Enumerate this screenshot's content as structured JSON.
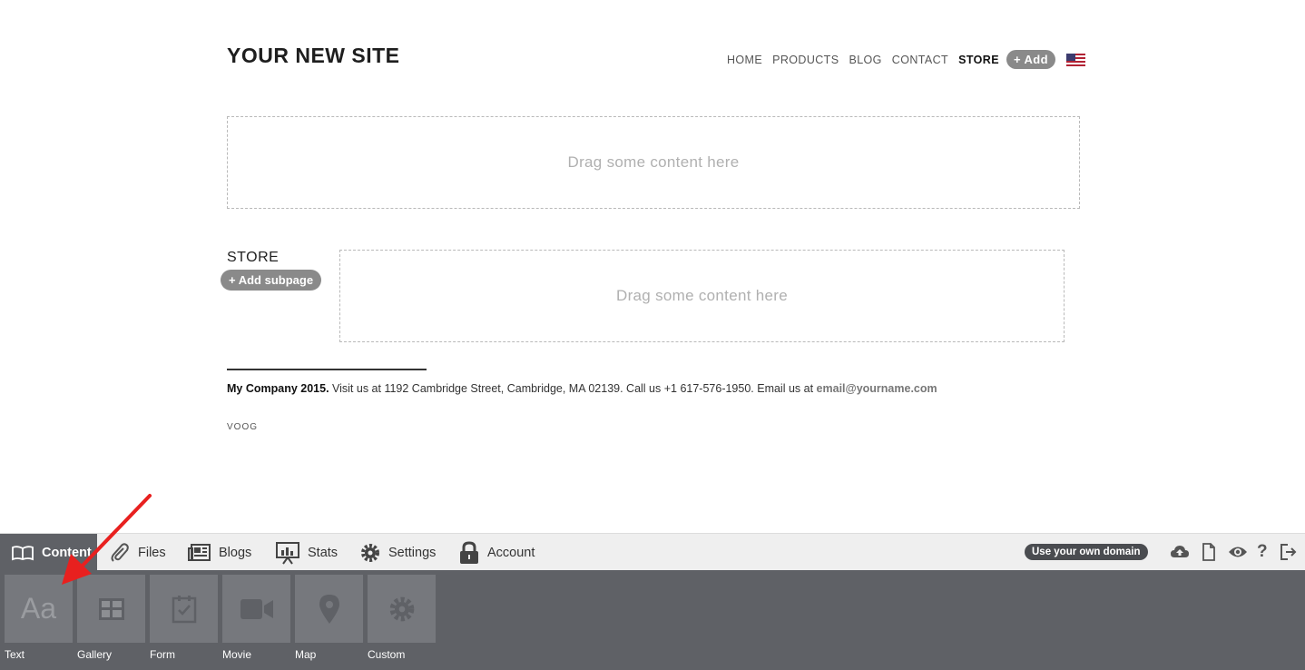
{
  "site": {
    "title": "YOUR NEW SITE",
    "nav": [
      "HOME",
      "PRODUCTS",
      "BLOG",
      "CONTACT",
      "STORE"
    ],
    "add_label": "+ Add",
    "dropzone_label": "Drag some content here"
  },
  "store": {
    "heading": "STORE",
    "add_subpage_label": "+ Add subpage",
    "dropzone_label": "Drag some content here"
  },
  "footer": {
    "company": "My Company 2015.",
    "text": " Visit us at 1192 Cambridge Street, Cambridge, MA 02139. Call us +1 617-576-1950. Email us at ",
    "email": "email@yourname.com",
    "brand": "VOOG"
  },
  "toolbar": {
    "tabs": [
      "Content",
      "Files",
      "Blogs",
      "Stats",
      "Settings",
      "Account"
    ],
    "domain_button": "Use your own domain",
    "icons": [
      "cloud-upload-icon",
      "page-icon",
      "eye-icon",
      "help-icon",
      "logout-icon"
    ]
  },
  "palette": {
    "items": [
      "Text",
      "Gallery",
      "Form",
      "Movie",
      "Map",
      "Custom"
    ],
    "text_tile_glyph": "Aa"
  },
  "colors": {
    "toolbar_dark": "#5f6166",
    "tile": "#76787d",
    "arrow": "#e8201f"
  }
}
